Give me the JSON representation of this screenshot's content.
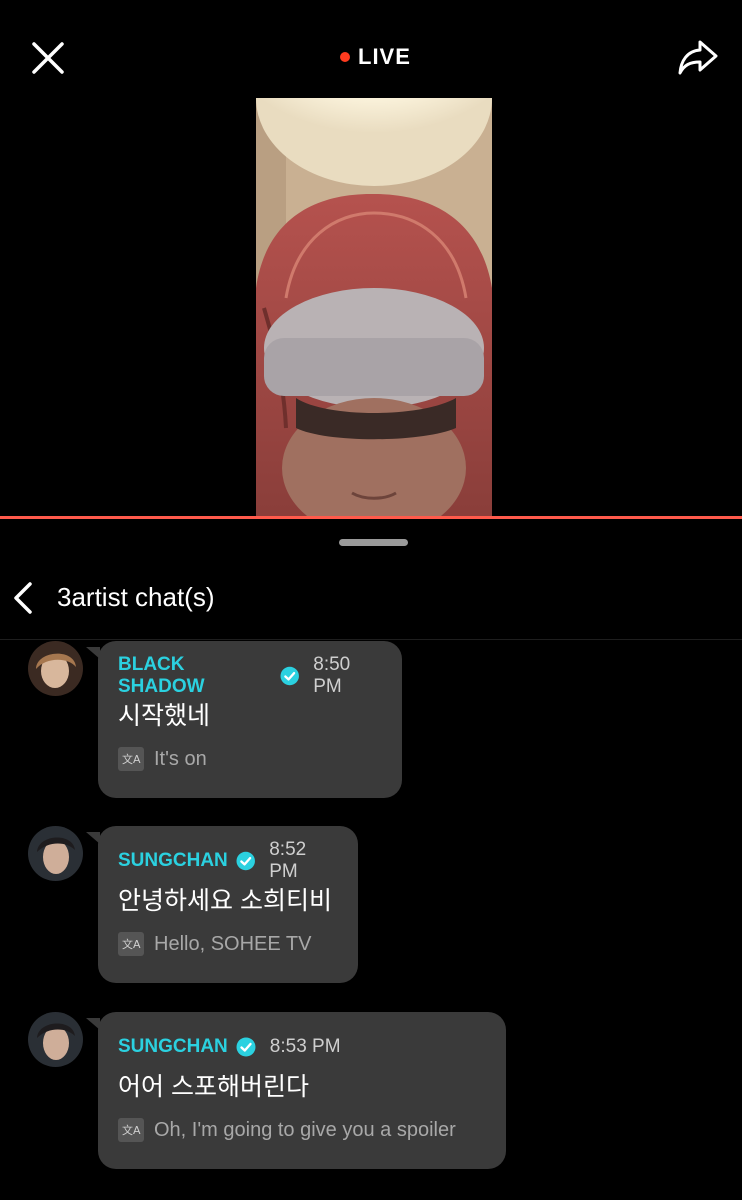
{
  "topbar": {
    "live_label": "LIVE",
    "close_icon": "close-icon",
    "share_icon": "share-icon",
    "live_color": "#ff3b1f"
  },
  "player": {
    "progress_color": "#ff5a4b"
  },
  "chat_header": {
    "title": "3artist chat(s)",
    "back_icon": "chevron-left-icon"
  },
  "messages": [
    {
      "author": "BLACK SHADOW",
      "verified": true,
      "time": "8:50 PM",
      "text": "시작했네",
      "translation": "It's on"
    },
    {
      "author": "SUNGCHAN",
      "verified": true,
      "time": "8:52 PM",
      "text": "안녕하세요 소희티비",
      "translation": "Hello, SOHEE TV"
    },
    {
      "author": "SUNGCHAN",
      "verified": true,
      "time": "8:53 PM",
      "text": "어어 스포해버린다",
      "translation": "Oh, I'm going to give you a spoiler"
    }
  ],
  "colors": {
    "accent_name": "#2bd1e0",
    "bubble_bg": "#3a3a3a",
    "background": "#000000"
  }
}
